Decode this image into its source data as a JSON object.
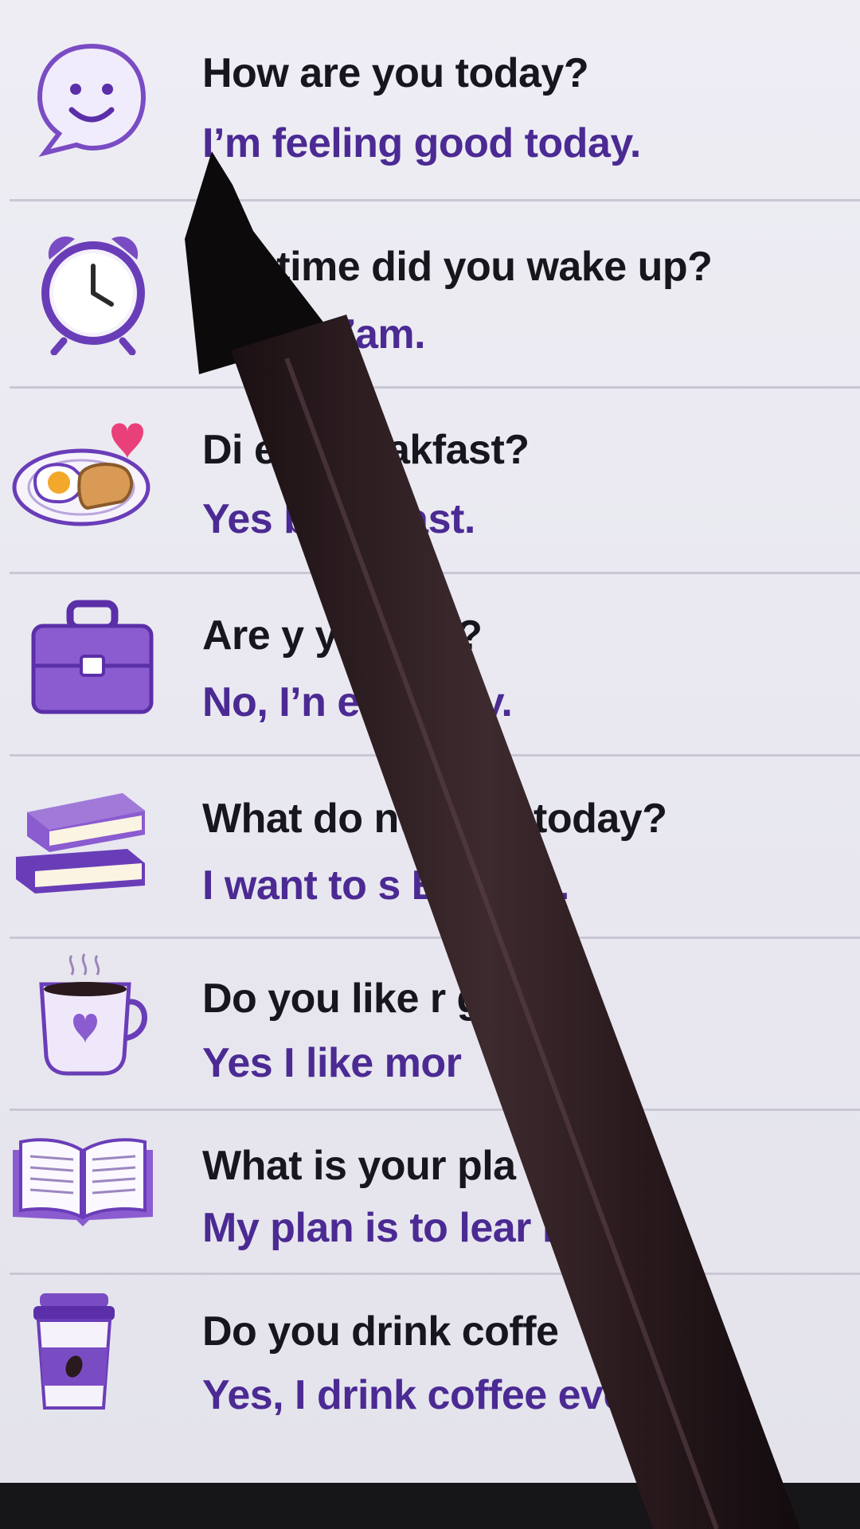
{
  "rows": [
    {
      "icon": "smiley-speech-bubble-icon",
      "question": "How are you today?",
      "answer": "I’m feeling good today."
    },
    {
      "icon": "alarm-clock-icon",
      "question": "W      t time did you wake up?",
      "answer": "I        up at 7am."
    },
    {
      "icon": "breakfast-plate-icon",
      "question": "Di          eat breakfast?",
      "answer": "Yes             breakfast."
    },
    {
      "icon": "briefcase-icon",
      "question": "Are y           y today?",
      "answer": "No, I’n           ery busy."
    },
    {
      "icon": "books-stack-icon",
      "question": "What do              nt to do today?",
      "answer": "I want to s          English."
    },
    {
      "icon": "coffee-mug-heart-icon",
      "question": "Do you like r             gs?",
      "answer": "Yes I like mor"
    },
    {
      "icon": "open-book-icon",
      "question": "What is your pla              ?",
      "answer": "My plan is to lear              h."
    },
    {
      "icon": "takeaway-coffee-cup-icon",
      "question": "Do you drink coffe",
      "answer": "Yes, I drink coffee ever               ng."
    }
  ],
  "colors": {
    "question": "#17161c",
    "answer": "#4b2a93",
    "icon_purple": "#7a4cc4",
    "pen": "#2a1a1e"
  }
}
